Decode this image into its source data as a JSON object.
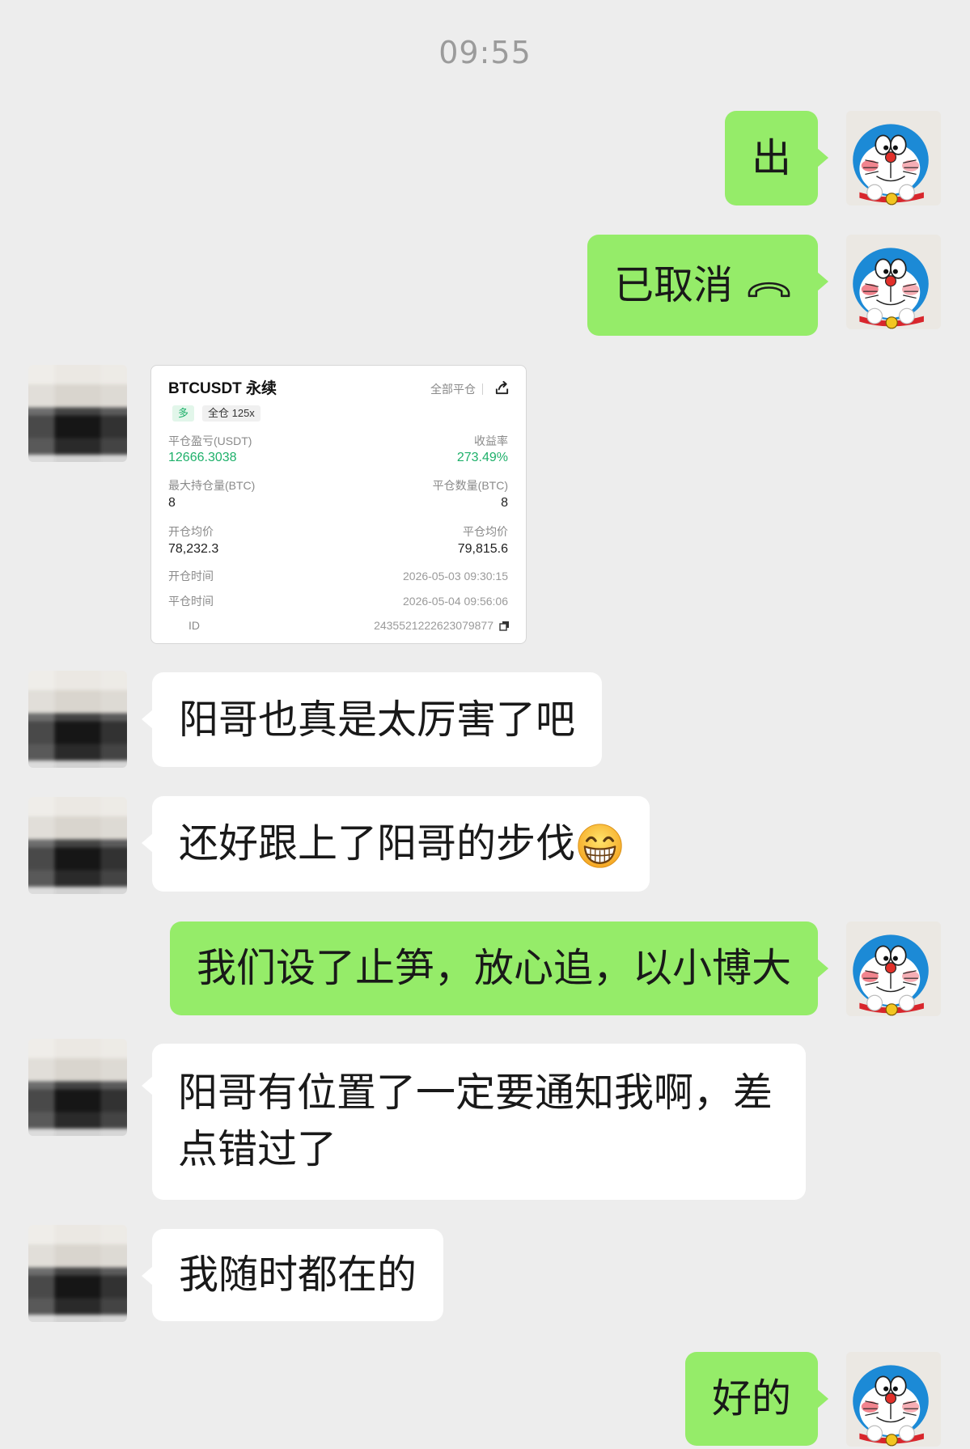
{
  "timestamp": "09:55",
  "colors": {
    "background": "#ededed",
    "sent_bubble": "#95ec69",
    "received_bubble": "#ffffff",
    "profit_green": "#1eb06a",
    "long_tag_bg": "#e2f6ea"
  },
  "avatars": {
    "self": "doraemon-avatar",
    "contact": "blurred-avatar"
  },
  "messages": [
    {
      "side": "sent",
      "text": "出"
    },
    {
      "side": "sent",
      "text": "已取消",
      "icon": "phone-hangup-icon"
    },
    {
      "side": "received",
      "type": "image",
      "card": {
        "title": "BTCUSDT 永续",
        "close_all_label": "全部平仓",
        "share_icon": "share-icon",
        "direction_tag": "多",
        "margin_tag": "全仓 125x",
        "pnl_label": "平仓盈亏(USDT)",
        "pnl_value": "12666.3038",
        "roi_label": "收益率",
        "roi_value": "273.49%",
        "max_position_label": "最大持仓量(BTC)",
        "max_position_value": "8",
        "close_qty_label": "平仓数量(BTC)",
        "close_qty_value": "8",
        "open_price_label": "开仓均价",
        "open_price_value": "78,232.3",
        "close_price_label": "平仓均价",
        "close_price_value": "79,815.6",
        "open_time_label": "开仓时间",
        "open_time_value": "2026-05-03 09:30:15",
        "close_time_label": "平仓时间",
        "close_time_value": "2026-05-04 09:56:06",
        "id_label": "ID",
        "id_value": "2435521222623079877",
        "copy_icon": "copy-icon"
      }
    },
    {
      "side": "received",
      "text": "阳哥也真是太厉害了吧"
    },
    {
      "side": "received",
      "text": "还好跟上了阳哥的步伐",
      "emoji": "grinning-face-with-smiling-eyes-icon"
    },
    {
      "side": "sent",
      "text": "我们设了止笋，放心追，以小博大"
    },
    {
      "side": "received",
      "text": "阳哥有位置了一定要通知我啊，差点错过了"
    },
    {
      "side": "received",
      "text": "我随时都在的"
    },
    {
      "side": "sent",
      "text": "好的"
    }
  ]
}
